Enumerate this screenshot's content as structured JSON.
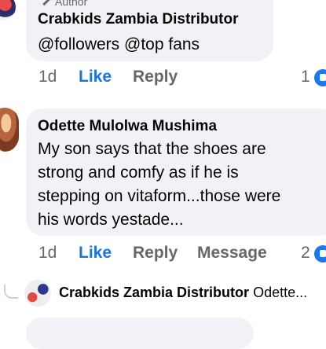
{
  "comment_1": {
    "author_tag": "Author",
    "name": "Crabkids Zambia Distributor",
    "text": "@followers @top fans",
    "time": "1d",
    "like_label": "Like",
    "reply_label": "Reply",
    "reaction_count": "1"
  },
  "comment_2": {
    "name": "Odette Mulolwa Mushima",
    "text_lines": [
      "My son says that the shoes are",
      "strong and comfy as if he is",
      "stepping on vitaform...those were",
      "his words yestade..."
    ],
    "time": "1d",
    "like_label": "Like",
    "reply_label": "Reply",
    "message_label": "Message",
    "reaction_count": "2"
  },
  "reply_preview": {
    "name": "Crabkids Zambia Distributor",
    "text": "Odette..."
  },
  "colors": {
    "bubble": "#f0f2f5",
    "like": "#1b74e4",
    "muted": "#65676b",
    "reaction": "#1877f2"
  },
  "icons": {
    "author_badge": "pencil-icon",
    "reaction": "like-reaction-icon"
  }
}
